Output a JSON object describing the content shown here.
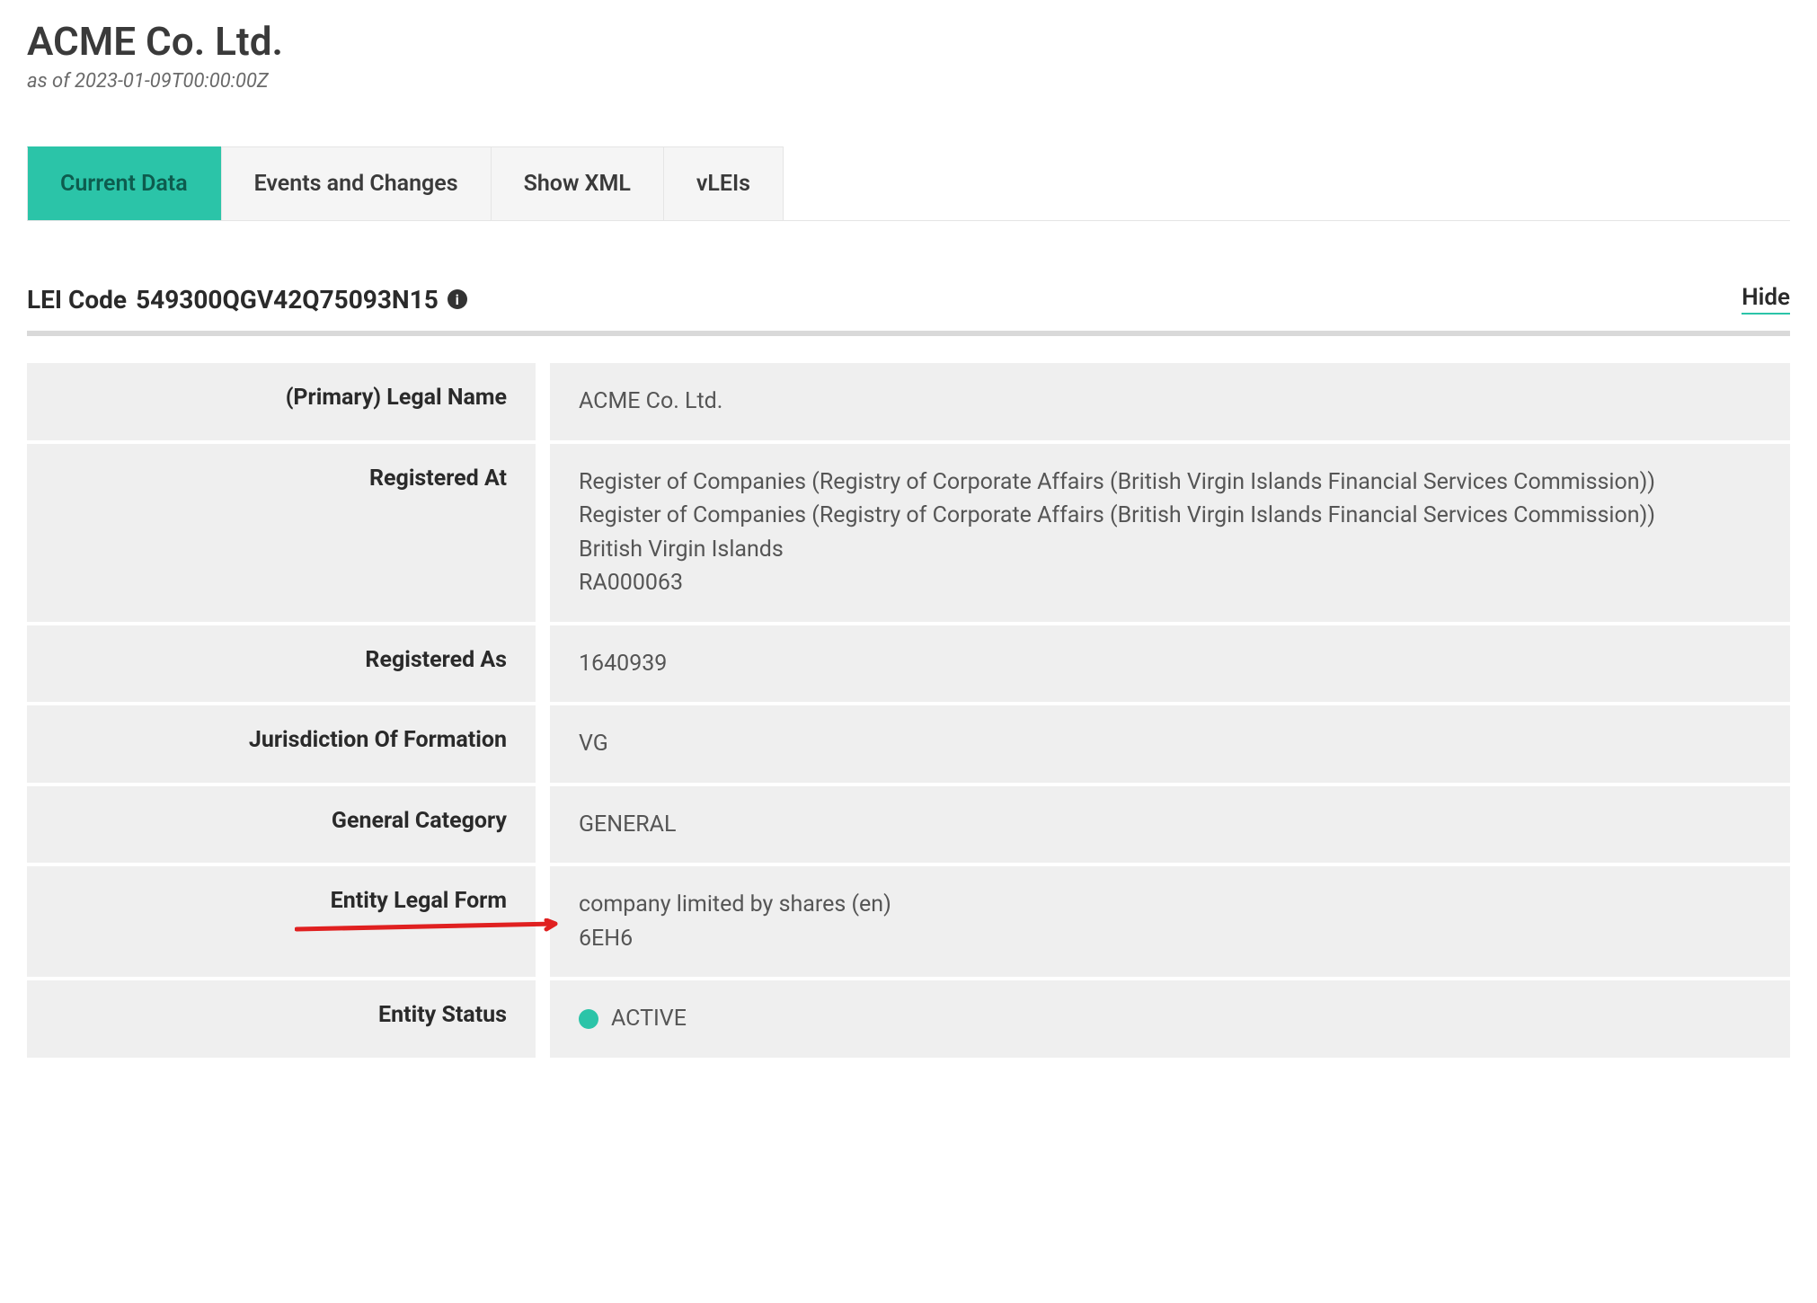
{
  "header": {
    "title": "ACME Co. Ltd.",
    "timestamp": "as of 2023-01-09T00:00:00Z"
  },
  "tabs": [
    {
      "label": "Current Data",
      "active": true
    },
    {
      "label": "Events and Changes",
      "active": false
    },
    {
      "label": "Show XML",
      "active": false
    },
    {
      "label": "vLEIs",
      "active": false
    }
  ],
  "section": {
    "lei_label": "LEI Code",
    "lei_value": "549300QGV42Q75093N15",
    "hide_label": "Hide"
  },
  "rows": [
    {
      "label": "(Primary) Legal Name",
      "lines": [
        "ACME Co. Ltd."
      ]
    },
    {
      "label": "Registered At",
      "lines": [
        "Register of Companies (Registry of Corporate Affairs (British Virgin Islands Financial Services Commission))",
        "Register of Companies (Registry of Corporate Affairs (British Virgin Islands Financial Services Commission))",
        "British Virgin Islands",
        "RA000063"
      ]
    },
    {
      "label": "Registered As",
      "lines": [
        "1640939"
      ]
    },
    {
      "label": "Jurisdiction Of Formation",
      "lines": [
        "VG"
      ]
    },
    {
      "label": "General Category",
      "lines": [
        "GENERAL"
      ]
    },
    {
      "label": "Entity Legal Form",
      "lines": [
        "company limited by shares (en)",
        "6EH6"
      ],
      "annotated": true
    },
    {
      "label": "Entity Status",
      "status": "ACTIVE",
      "status_color": "#2bc4a8"
    }
  ]
}
